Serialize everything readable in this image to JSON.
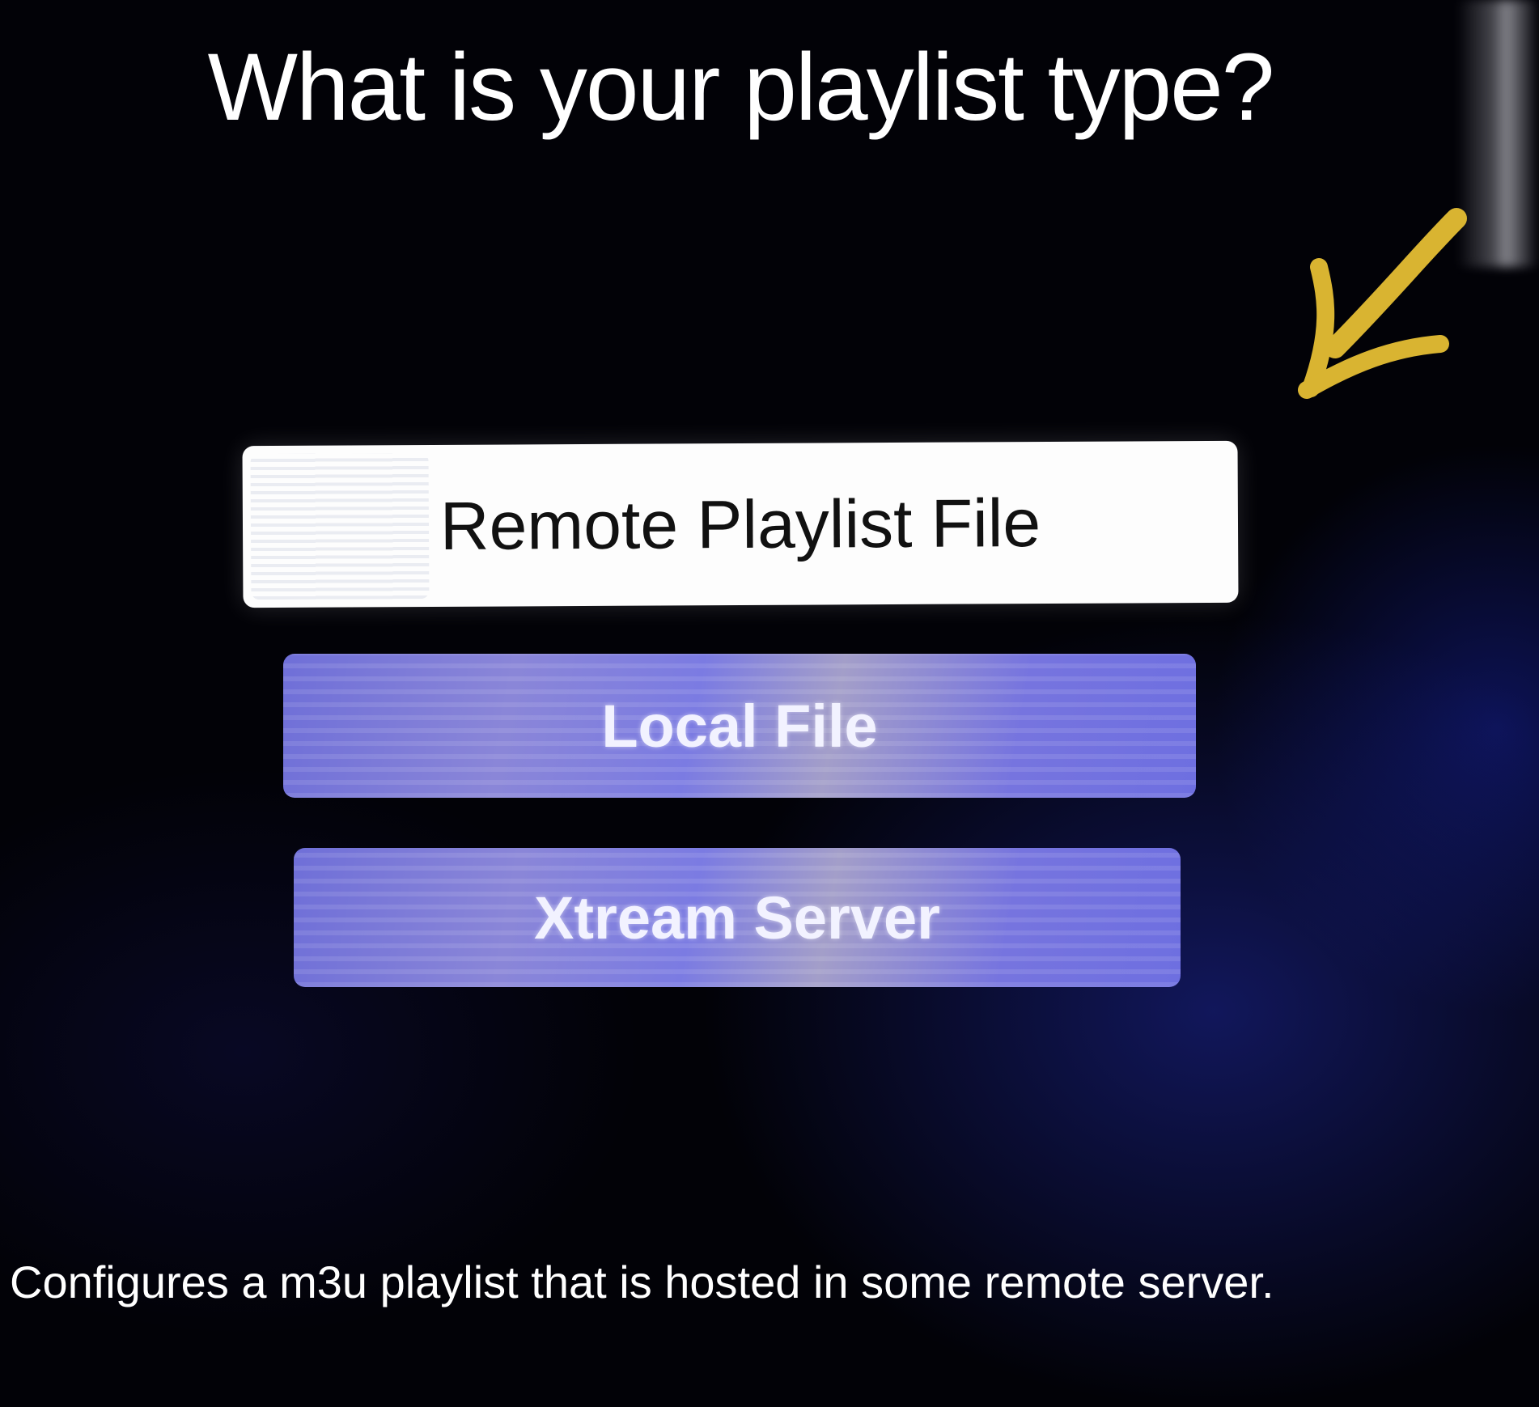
{
  "screen": {
    "title": "What is your playlist type?",
    "options": [
      {
        "label": "Remote Playlist File",
        "focused": true
      },
      {
        "label": "Local File",
        "focused": false
      },
      {
        "label": "Xtream Server",
        "focused": false
      }
    ],
    "description": "Configures a m3u playlist that is hosted in some remote server."
  },
  "annotation": {
    "icon": "arrow-annotation-icon",
    "color": "#d9b431"
  }
}
